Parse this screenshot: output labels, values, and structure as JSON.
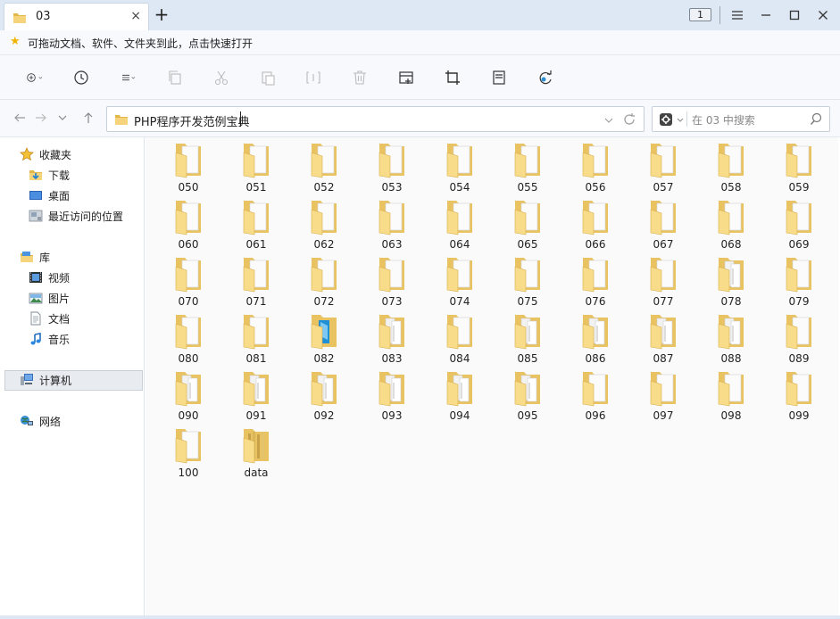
{
  "window": {
    "tab_title": "03",
    "tab_close": "×",
    "new_tab": "+",
    "instance_badge": "1"
  },
  "favorites_bar": {
    "hint": "可拖动文档、软件、文件夹到此，点击快速打开"
  },
  "address": {
    "path": "PHP程序开发范例宝典"
  },
  "search": {
    "placeholder": "在 03 中搜索"
  },
  "sidebar": {
    "favorites": "收藏夹",
    "downloads": "下载",
    "desktop": "桌面",
    "recent": "最近访问的位置",
    "libraries": "库",
    "videos": "视频",
    "pictures": "图片",
    "documents": "文档",
    "music": "音乐",
    "computer": "计算机",
    "network": "网络"
  },
  "files": [
    "050",
    "051",
    "052",
    "053",
    "054",
    "055",
    "056",
    "057",
    "058",
    "059",
    "060",
    "061",
    "062",
    "063",
    "064",
    "065",
    "066",
    "067",
    "068",
    "069",
    "070",
    "071",
    "072",
    "073",
    "074",
    "075",
    "076",
    "077",
    "078",
    "079",
    "080",
    "081",
    "082",
    "083",
    "084",
    "085",
    "086",
    "087",
    "088",
    "089",
    "090",
    "091",
    "092",
    "093",
    "094",
    "095",
    "096",
    "097",
    "098",
    "099",
    "100",
    "data"
  ],
  "folder_colors": {
    "folder_back": "#e9c261",
    "folder_front": "#f8dc8a",
    "paper": "#fbfbfb",
    "accent_blue": "#1f8fd6"
  }
}
